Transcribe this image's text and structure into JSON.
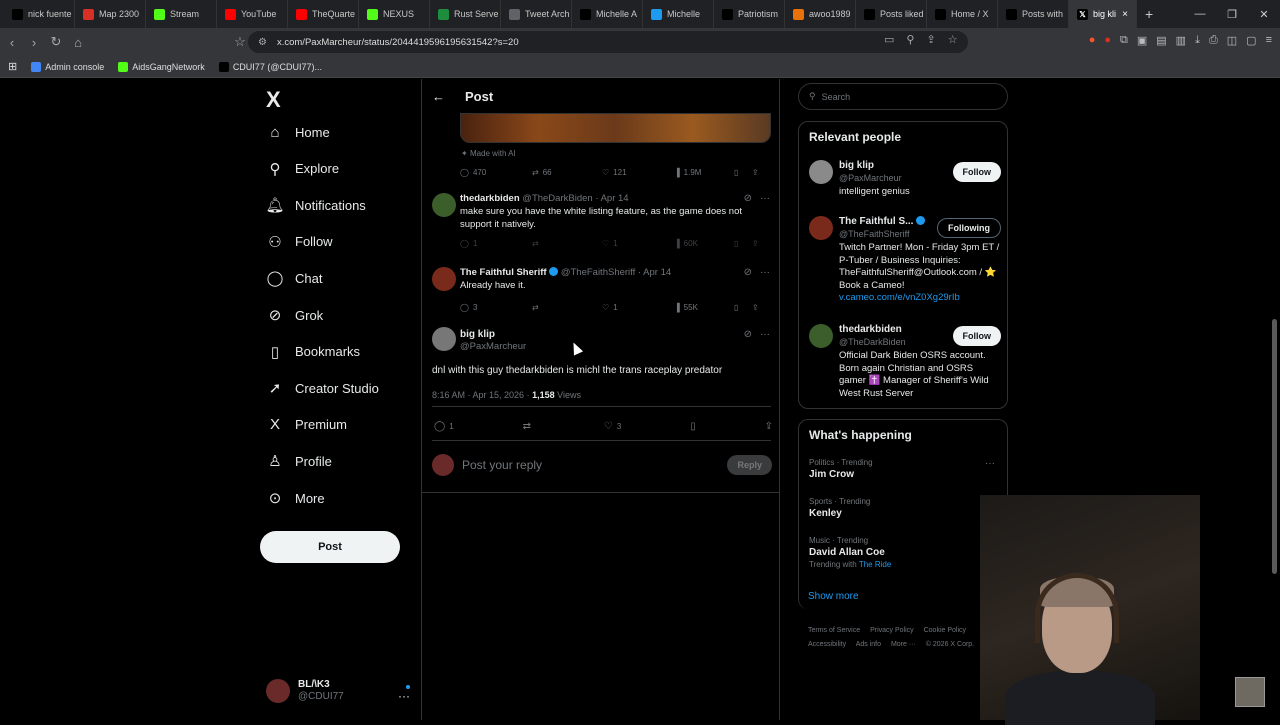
{
  "browser": {
    "tabs": [
      {
        "label": "nick fuente",
        "icon": "x-icon",
        "color": "#000000"
      },
      {
        "label": "Map 2300",
        "icon": "map-pin-icon",
        "color": "#d93025"
      },
      {
        "label": "Stream",
        "icon": "kick-icon",
        "color": "#53fc18"
      },
      {
        "label": "YouTube",
        "icon": "youtube-icon",
        "color": "#ff0000"
      },
      {
        "label": "TheQuarte",
        "icon": "youtube-icon",
        "color": "#ff0000"
      },
      {
        "label": "NEXUS",
        "icon": "kick-icon",
        "color": "#53fc18"
      },
      {
        "label": "Rust Serve",
        "icon": "server-icon",
        "color": "#1e8e3e"
      },
      {
        "label": "Tweet Arch",
        "icon": "archive-icon",
        "color": "#5f6368"
      },
      {
        "label": "Michelle A",
        "icon": "x-icon",
        "color": "#000000"
      },
      {
        "label": "Michelle",
        "icon": "twitter-icon",
        "color": "#1d9bf0"
      },
      {
        "label": "Patriotism",
        "icon": "x-icon",
        "color": "#000000"
      },
      {
        "label": "awoo1989",
        "icon": "globe-icon",
        "color": "#e8710a"
      },
      {
        "label": "Posts liked",
        "icon": "x-icon",
        "color": "#000000"
      },
      {
        "label": "Home / X",
        "icon": "x-icon",
        "color": "#000000"
      },
      {
        "label": "Posts with",
        "icon": "x-icon",
        "color": "#000000"
      }
    ],
    "active_tab": {
      "label": "big kli",
      "close": "×"
    },
    "new_tab": "+",
    "url": "x.com/PaxMarcheur/status/2044419596195631542?s=20",
    "bookmarks": [
      {
        "label": "Admin console",
        "color": "#4285f4"
      },
      {
        "label": "AidsGangNetwork",
        "color": "#53fc18"
      },
      {
        "label": "CDUI77 (@CDUI77)...",
        "color": "#000000"
      }
    ]
  },
  "nav": {
    "logo": "X",
    "items": [
      {
        "label": "Home",
        "icon": "home-icon",
        "glyph": "⌂"
      },
      {
        "label": "Explore",
        "icon": "search-icon",
        "glyph": "⚲"
      },
      {
        "label": "Notifications",
        "icon": "bell-icon",
        "glyph": "🔔︎"
      },
      {
        "label": "Follow",
        "icon": "person-add-icon",
        "glyph": "⚇"
      },
      {
        "label": "Chat",
        "icon": "chat-icon",
        "glyph": "◯"
      },
      {
        "label": "Grok",
        "icon": "grok-icon",
        "glyph": "⊘"
      },
      {
        "label": "Bookmarks",
        "icon": "bookmark-icon",
        "glyph": "▯"
      },
      {
        "label": "Creator Studio",
        "icon": "rocket-icon",
        "glyph": "➚"
      },
      {
        "label": "Premium",
        "icon": "x-premium-icon",
        "glyph": "X"
      },
      {
        "label": "Profile",
        "icon": "profile-icon",
        "glyph": "♙"
      },
      {
        "label": "More",
        "icon": "more-circle-icon",
        "glyph": "⊙"
      }
    ],
    "post_button": "Post",
    "account": {
      "name": "BL/\\K3",
      "handle": "@CDUI77"
    }
  },
  "timeline": {
    "title": "Post",
    "made_with_ai": "Made with AI",
    "media_actions": {
      "replies": "470",
      "reposts": "66",
      "likes": "121",
      "views": "1.9M"
    },
    "replies": [
      {
        "name": "thedarkbiden",
        "handle": "@TheDarkBiden",
        "date": "· Apr 14",
        "verified": false,
        "text": "make sure you have the white listing feature, as the game does not support it natively.",
        "actions": {
          "replies": "1",
          "reposts": "",
          "likes": "1",
          "views": "60K"
        },
        "avatar_color": "#3b5e2b"
      },
      {
        "name": "The Faithful Sheriff",
        "handle": "@TheFaithSheriff",
        "date": "· Apr 14",
        "verified": true,
        "text": "Already have it.",
        "actions": {
          "replies": "3",
          "reposts": "",
          "likes": "1",
          "views": "55K"
        },
        "avatar_color": "#7a2a1a"
      }
    ],
    "main_post": {
      "name": "big klip",
      "handle": "@PaxMarcheur",
      "text": "dnl with this guy thedarkbiden is michl the trans raceplay predator",
      "time": "8:16 AM · Apr 15, 2026 ·",
      "views": "1,158",
      "views_label": "Views",
      "actions": {
        "replies": "1",
        "reposts": "",
        "likes": "3"
      }
    },
    "reply_placeholder": "Post your reply",
    "reply_button": "Reply"
  },
  "sidebar": {
    "search_placeholder": "Search",
    "relevant_title": "Relevant people",
    "people": [
      {
        "name": "big klip",
        "handle": "@PaxMarcheur",
        "bio": "intelligent genius",
        "button": "Follow",
        "link": "",
        "avatar_color": "#8a8a8a"
      },
      {
        "name": "The Faithful S...",
        "handle": "@TheFaithSheriff",
        "bio": "Twitch Partner! Mon - Friday 3pm ET / P-Tuber / Business Inquiries: TheFaithfulSheriff@Outlook.com / ⭐ Book a Cameo!",
        "link": "v.cameo.com/e/vnZ0Xg29rIb",
        "button": "Following",
        "avatar_color": "#7a2a1a"
      },
      {
        "name": "thedarkbiden",
        "handle": "@TheDarkBiden",
        "bio": "Official Dark Biden OSRS account. Born again Christian and OSRS gamer ✝️ Manager of Sheriff's Wild West Rust Server",
        "link": "",
        "button": "Follow",
        "avatar_color": "#3b5e2b"
      }
    ],
    "happening_title": "What's happening",
    "trends": [
      {
        "context": "Politics · Trending",
        "title": "Jim Crow",
        "with": "",
        "with_link": ""
      },
      {
        "context": "Sports · Trending",
        "title": "Kenley",
        "with": "",
        "with_link": ""
      },
      {
        "context": "Music · Trending",
        "title": "David Allan Coe",
        "with": "Trending with",
        "with_link": "The Ride"
      }
    ],
    "show_more": "Show more",
    "footer": [
      "Terms of Service",
      "Privacy Policy",
      "Cookie Policy",
      "Accessibility",
      "Ads info",
      "More ···",
      "© 2026 X Corp."
    ]
  }
}
